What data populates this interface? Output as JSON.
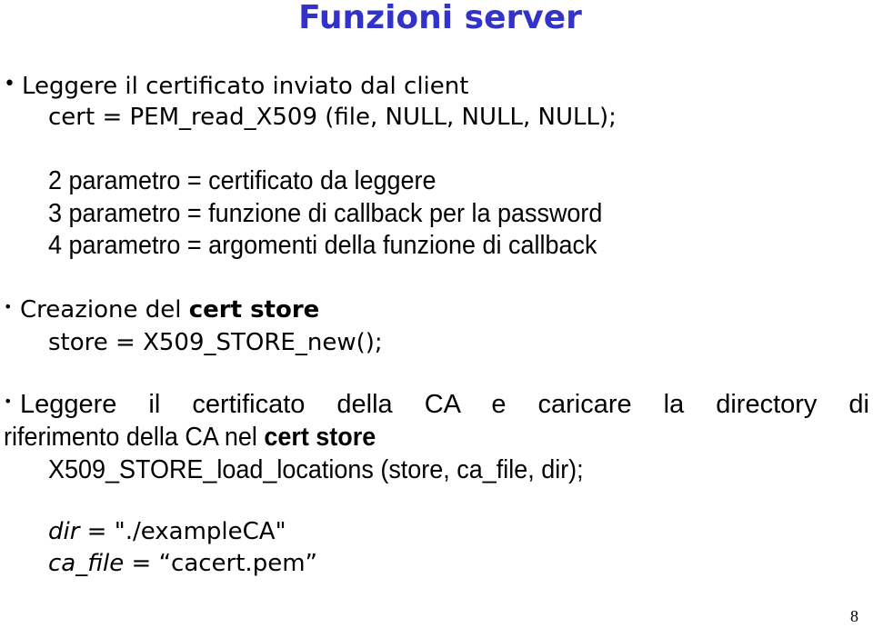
{
  "slide": {
    "title": "Funzioni server",
    "page_number": "8",
    "bullet_glyph": "•",
    "section1": {
      "bullet": "Leggere il certificato inviato dal client",
      "code": "cert = PEM_read_X509 (file, NULL, NULL, NULL);",
      "params": [
        "2  parametro = certificato da leggere",
        "3  parametro = funzione di callback per la password",
        "4  parametro = argomenti della funzione di callback"
      ]
    },
    "section2": {
      "bullet_prefix": "Creazione del ",
      "bullet_bold": "cert store",
      "code": "store = X509_STORE_new();"
    },
    "section3": {
      "bullet_line1": "Leggere il certificato della CA e caricare la directory di",
      "bullet_line2_prefix": "riferimento della CA nel ",
      "bullet_line2_bold": "cert store",
      "code": "X509_STORE_load_locations (store, ca_file, dir);"
    },
    "section4": {
      "dir_name": "dir",
      "dir_value": " = \"./exampleCA\"",
      "cafile_name": "ca_file",
      "cafile_value": " = “cacert.pem”"
    }
  }
}
